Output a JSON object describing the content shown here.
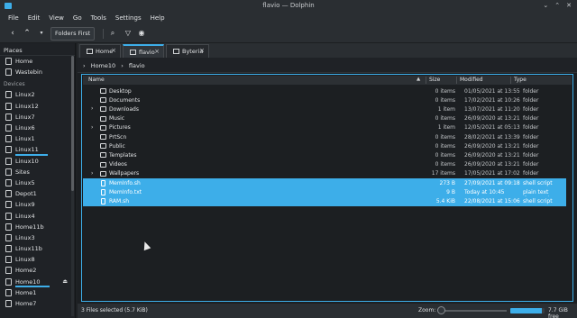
{
  "window": {
    "title": "flavio — Dolphin",
    "controls": [
      "⌄",
      "⌃",
      "✕"
    ]
  },
  "menu": [
    "File",
    "Edit",
    "View",
    "Go",
    "Tools",
    "Settings",
    "Help"
  ],
  "toolbar": {
    "folders_first": "Folders First"
  },
  "places": {
    "header": "Places",
    "top": [
      "Home",
      "Wastebin"
    ],
    "devices_label": "Devices",
    "devices": [
      "Linux2",
      "Linux12",
      "Linux7",
      "Linux6",
      "Linux1",
      "Linux11",
      "Linux10",
      "Sites",
      "Linux5",
      "Depot1",
      "Linux9",
      "Linux4",
      "Home11b",
      "Linux3",
      "Linux11b",
      "Linux8",
      "Home2",
      "Home10",
      "Home1",
      "Home7"
    ]
  },
  "tabs": [
    {
      "label": "Home"
    },
    {
      "label": "flavio"
    },
    {
      "label": "Byteria"
    }
  ],
  "breadcrumb": [
    "Home10",
    "flavio"
  ],
  "columns": {
    "name": "Name",
    "size": "Size",
    "modified": "Modified",
    "type": "Type"
  },
  "files": [
    {
      "name": "Desktop",
      "size": "0 items",
      "modified": "01/05/2021 at 13:55",
      "type": "folder"
    },
    {
      "name": "Documents",
      "size": "0 items",
      "modified": "17/02/2021 at 10:26",
      "type": "folder"
    },
    {
      "name": "Downloads",
      "size": "1 item",
      "modified": "13/07/2021 at 11:20",
      "type": "folder"
    },
    {
      "name": "Music",
      "size": "0 items",
      "modified": "26/09/2020 at 13:21",
      "type": "folder"
    },
    {
      "name": "Pictures",
      "size": "1 item",
      "modified": "12/05/2021 at 05:13",
      "type": "folder"
    },
    {
      "name": "PrtScn",
      "size": "0 items",
      "modified": "28/02/2021 at 13:39",
      "type": "folder"
    },
    {
      "name": "Public",
      "size": "0 items",
      "modified": "26/09/2020 at 13:21",
      "type": "folder"
    },
    {
      "name": "Templates",
      "size": "0 items",
      "modified": "26/09/2020 at 13:21",
      "type": "folder"
    },
    {
      "name": "Videos",
      "size": "0 items",
      "modified": "26/09/2020 at 13:21",
      "type": "folder"
    },
    {
      "name": "Wallpapers",
      "size": "17 items",
      "modified": "17/05/2021 at 17:02",
      "type": "folder"
    },
    {
      "name": "MemInfo.sh",
      "size": "273 B",
      "modified": "27/09/2021 at 09:18",
      "type": "shell script"
    },
    {
      "name": "MemInfo.txt",
      "size": "9 B",
      "modified": "Today at 10:45",
      "type": "plain text document"
    },
    {
      "name": "RAM.sh",
      "size": "5.4 KiB",
      "modified": "22/08/2021 at 15:06",
      "type": "shell script"
    }
  ],
  "status": {
    "selection": "3 Files selected (5.7 KiB)",
    "zoom_label": "Zoom:",
    "free_space": "7.7 GiB free",
    "used_fraction": 0.92
  },
  "colors": {
    "accent": "#3daee9",
    "background": "#1e2124",
    "panel": "#2a2e32"
  }
}
